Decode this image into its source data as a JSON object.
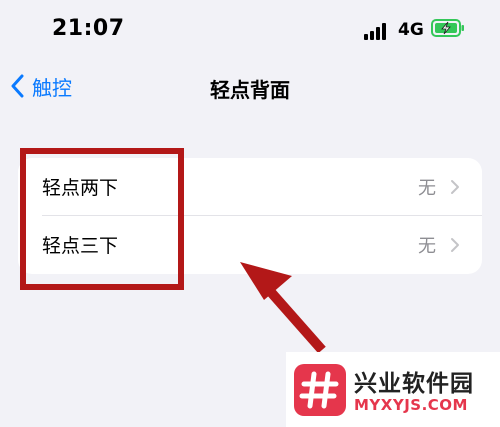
{
  "status_bar": {
    "time": "21:07",
    "network": "4G",
    "battery_state": "charging",
    "signal_bars": 4
  },
  "nav": {
    "back_label": "触控",
    "title": "轻点背面"
  },
  "rows": [
    {
      "label": "轻点两下",
      "value": "无"
    },
    {
      "label": "轻点三下",
      "value": "无"
    }
  ],
  "watermark": {
    "name": "兴业软件园",
    "url": "MYXYJS.COM"
  },
  "colors": {
    "accent": "#0a7aff",
    "highlight": "#b31818",
    "battery": "#34c759",
    "watermark": "#e5364c",
    "background": "#f2f2f7"
  },
  "icons": {
    "back": "chevron-left-icon",
    "row": "chevron-right-icon",
    "signal": "cellular-signal-icon",
    "battery": "battery-charging-icon"
  }
}
